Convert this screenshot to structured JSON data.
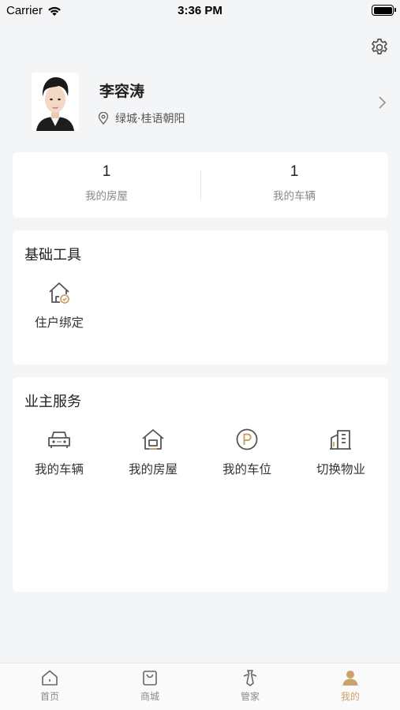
{
  "status_bar": {
    "carrier": "Carrier",
    "time": "3:36 PM"
  },
  "profile": {
    "name": "李容涛",
    "location": "绿城·桂语朝阳"
  },
  "stats": [
    {
      "value": "1",
      "label": "我的房屋"
    },
    {
      "value": "1",
      "label": "我的车辆"
    }
  ],
  "tools": {
    "title": "基础工具",
    "items": [
      {
        "label": "住户绑定",
        "icon": "house-bind-icon"
      }
    ]
  },
  "services": {
    "title": "业主服务",
    "items": [
      {
        "label": "我的车辆",
        "icon": "car-icon"
      },
      {
        "label": "我的房屋",
        "icon": "house-icon"
      },
      {
        "label": "我的车位",
        "icon": "parking-icon"
      },
      {
        "label": "切换物业",
        "icon": "building-icon"
      }
    ]
  },
  "tabbar": [
    {
      "label": "首页",
      "icon": "home-icon"
    },
    {
      "label": "商城",
      "icon": "shopping-bag-icon"
    },
    {
      "label": "管家",
      "icon": "butler-icon"
    },
    {
      "label": "我的",
      "icon": "user-icon",
      "active": true
    }
  ],
  "colors": {
    "accent": "#c9a36a",
    "background": "#f4f5f7",
    "icon_dark": "#555555"
  }
}
